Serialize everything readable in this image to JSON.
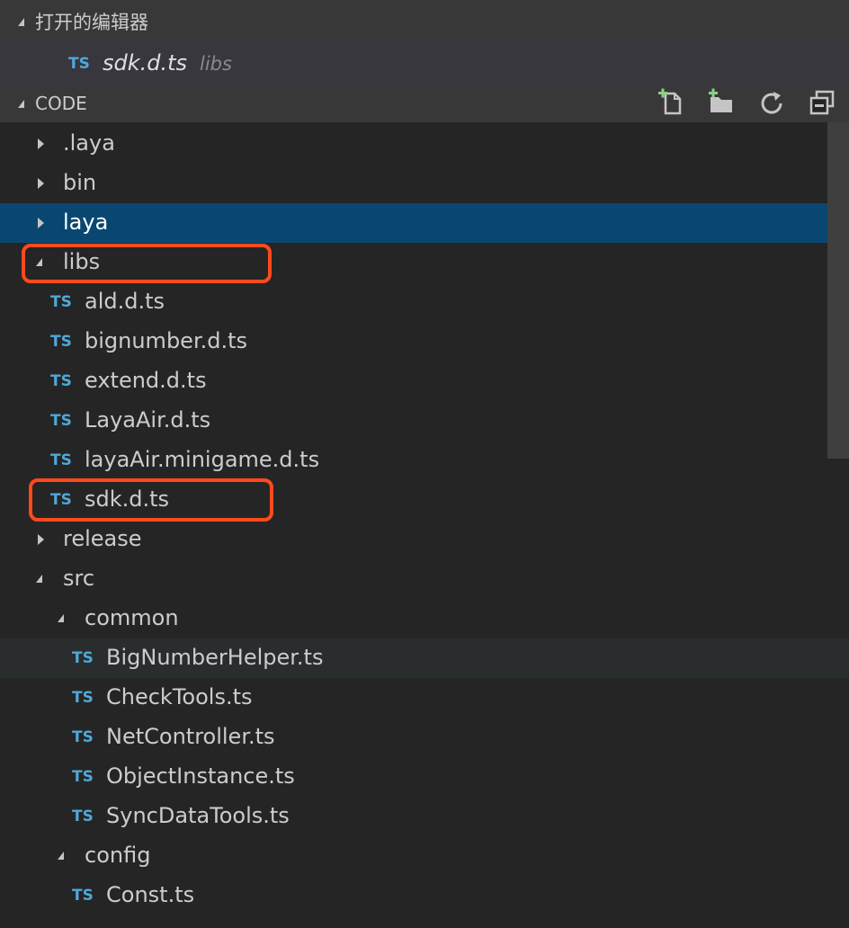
{
  "open_editors": {
    "header": "打开的编辑器",
    "items": [
      {
        "badge": "TS",
        "name": "sdk.d.ts",
        "folder": "libs"
      }
    ]
  },
  "explorer": {
    "header": "CODE",
    "toolbar": {
      "new_file_icon": "new-file-icon",
      "new_folder_icon": "new-folder-icon",
      "refresh_icon": "refresh-icon",
      "collapse_icon": "collapse-all-icon"
    },
    "tree": [
      {
        "label": ".laya",
        "kind": "folder",
        "state": "collapsed",
        "depth": 0
      },
      {
        "label": "bin",
        "kind": "folder",
        "state": "collapsed",
        "depth": 0
      },
      {
        "label": "laya",
        "kind": "folder",
        "state": "collapsed",
        "depth": 0,
        "selected": true
      },
      {
        "label": "libs",
        "kind": "folder",
        "state": "expanded",
        "depth": 0
      },
      {
        "label": "ald.d.ts",
        "kind": "file",
        "badge": "TS",
        "depth": 1
      },
      {
        "label": "bignumber.d.ts",
        "kind": "file",
        "badge": "TS",
        "depth": 1
      },
      {
        "label": "extend.d.ts",
        "kind": "file",
        "badge": "TS",
        "depth": 1
      },
      {
        "label": "LayaAir.d.ts",
        "kind": "file",
        "badge": "TS",
        "depth": 1
      },
      {
        "label": "layaAir.minigame.d.ts",
        "kind": "file",
        "badge": "TS",
        "depth": 1
      },
      {
        "label": "sdk.d.ts",
        "kind": "file",
        "badge": "TS",
        "depth": 1
      },
      {
        "label": "release",
        "kind": "folder",
        "state": "collapsed",
        "depth": 0
      },
      {
        "label": "src",
        "kind": "folder",
        "state": "expanded",
        "depth": 0
      },
      {
        "label": "common",
        "kind": "folder",
        "state": "expanded",
        "depth": 1
      },
      {
        "label": "BigNumberHelper.ts",
        "kind": "file",
        "badge": "TS",
        "depth": 2,
        "hover": true
      },
      {
        "label": "CheckTools.ts",
        "kind": "file",
        "badge": "TS",
        "depth": 2
      },
      {
        "label": "NetController.ts",
        "kind": "file",
        "badge": "TS",
        "depth": 2
      },
      {
        "label": "ObjectInstance.ts",
        "kind": "file",
        "badge": "TS",
        "depth": 2
      },
      {
        "label": "SyncDataTools.ts",
        "kind": "file",
        "badge": "TS",
        "depth": 2
      },
      {
        "label": "config",
        "kind": "folder",
        "state": "expanded",
        "depth": 1
      },
      {
        "label": "Const.ts",
        "kind": "file",
        "badge": "TS",
        "depth": 2
      }
    ]
  },
  "colors": {
    "selection": "#094771",
    "annotation_box": "#ff4a1c",
    "ts_badge": "#4fa8d8",
    "new_icon_plus": "#89d185"
  }
}
